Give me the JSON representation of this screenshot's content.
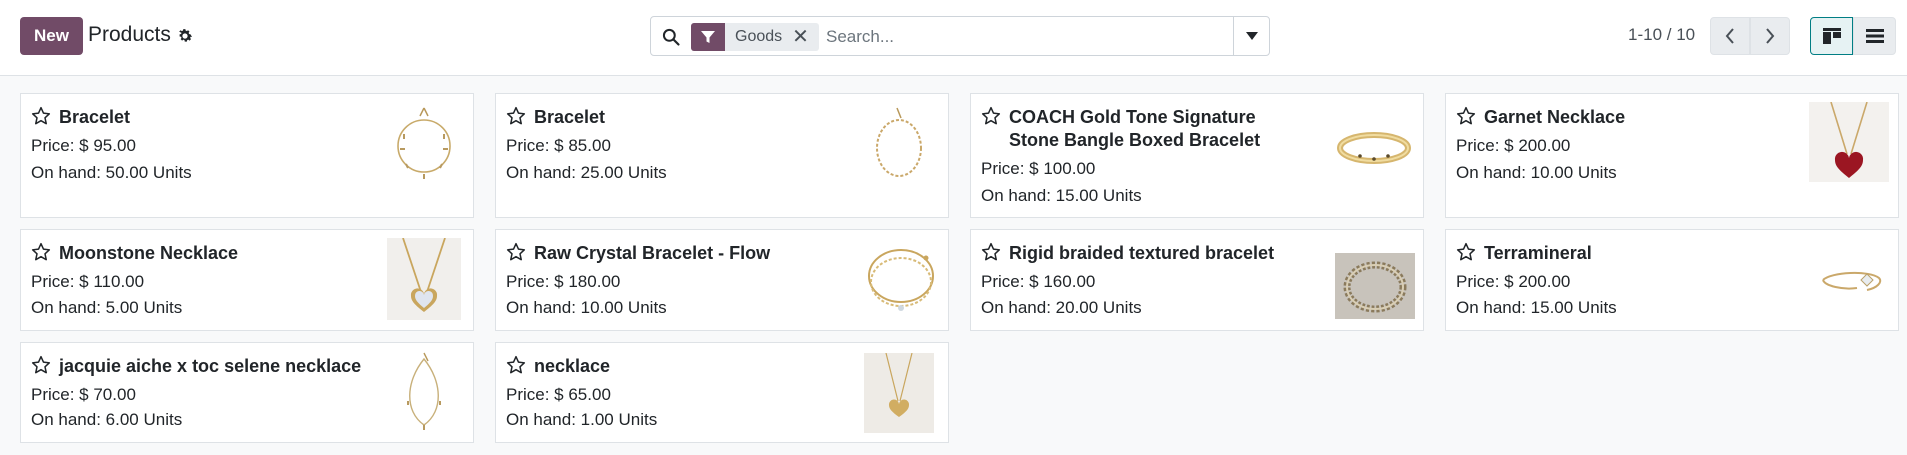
{
  "header": {
    "new_label": "New",
    "title": "Products",
    "gear_icon": "gear-icon"
  },
  "search": {
    "facet_label": "Goods",
    "facet_remove": "✕",
    "placeholder": "Search..."
  },
  "pager": {
    "value": "1-10 / 10"
  },
  "colors": {
    "brand": "#714b67",
    "accent": "#017e84"
  },
  "products": [
    {
      "name": "Bracelet",
      "price": "Price: $ 95.00",
      "on_hand": "On hand: 50.00 Units",
      "image": "charm-bracelet"
    },
    {
      "name": "Bracelet",
      "price": "Price: $ 85.00",
      "on_hand": "On hand: 25.00 Units",
      "image": "chain-bracelet"
    },
    {
      "name": "COACH Gold Tone Signature Stone Bangle Boxed Bracelet",
      "price": "Price: $ 100.00",
      "on_hand": "On hand: 15.00 Units",
      "image": "gold-bangle"
    },
    {
      "name": "Garnet Necklace",
      "price": "Price: $ 200.00",
      "on_hand": "On hand: 10.00 Units",
      "image": "heart-pendant-red"
    },
    {
      "name": "Moonstone Necklace",
      "price": "Price: $ 110.00",
      "on_hand": "On hand: 5.00 Units",
      "image": "heart-pendant-moonstone"
    },
    {
      "name": "Raw Crystal Bracelet - Flow",
      "price": "Price: $ 180.00",
      "on_hand": "On hand: 10.00 Units",
      "image": "layered-bracelet"
    },
    {
      "name": "Rigid braided textured bracelet",
      "price": "Price: $ 160.00",
      "on_hand": "On hand: 20.00 Units",
      "image": "braided-cuff"
    },
    {
      "name": "Terramineral",
      "price": "Price: $ 200.00",
      "on_hand": "On hand: 15.00 Units",
      "image": "open-cuff-stone"
    },
    {
      "name": "jacquie aiche x toc selene necklace",
      "price": "Price: $ 70.00",
      "on_hand": "On hand: 6.00 Units",
      "image": "drop-necklace"
    },
    {
      "name": "necklace",
      "price": "Price: $ 65.00",
      "on_hand": "On hand: 1.00 Units",
      "image": "heart-locket"
    }
  ]
}
